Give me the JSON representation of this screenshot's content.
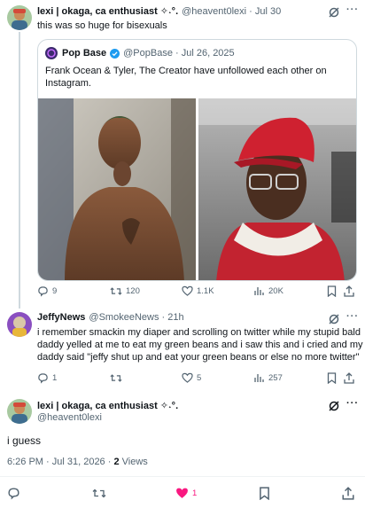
{
  "tweet1": {
    "display_name": "lexi | okaga, ca enthusiast ✧˖°.",
    "meta": "@heavent0lexi · Jul 30",
    "text": "this was so huge for bisexuals",
    "quote": {
      "name": "Pop Base",
      "meta": "@PopBase · Jul 26, 2025",
      "text_line1": "Frank Ocean & Tyler, The Creator have unfollowed each other on",
      "text_line2": "Instagram."
    },
    "stats": {
      "replies": "9",
      "retweets": "120",
      "likes": "1.1K",
      "views": "20K"
    }
  },
  "tweet2": {
    "display_name": "JeffyNews",
    "meta": "@SmokeeNews · 21h",
    "text_line1": "i remember smackin my diaper and scrolling on twitter while my stupid bald",
    "text_line2": "daddy yelled at me to eat my green beans and i saw this and i cried and my",
    "text_line3": "daddy said \"jeffy shut up and eat your green beans or else no more twitter\"",
    "stats": {
      "replies": "1",
      "retweets": "",
      "likes": "5",
      "views": "257"
    }
  },
  "main_tweet": {
    "display_name": "lexi | okaga, ca enthusiast ✧˖°.",
    "handle": "@heavent0lexi",
    "text": "i guess",
    "timestamp": "6:26 PM · Jul 31, 2026 · ",
    "views_count": "2",
    "views_label": " Views",
    "like_count": "1"
  },
  "colors": {
    "like_active": "#f91880",
    "verified": "#1d9bf0"
  }
}
